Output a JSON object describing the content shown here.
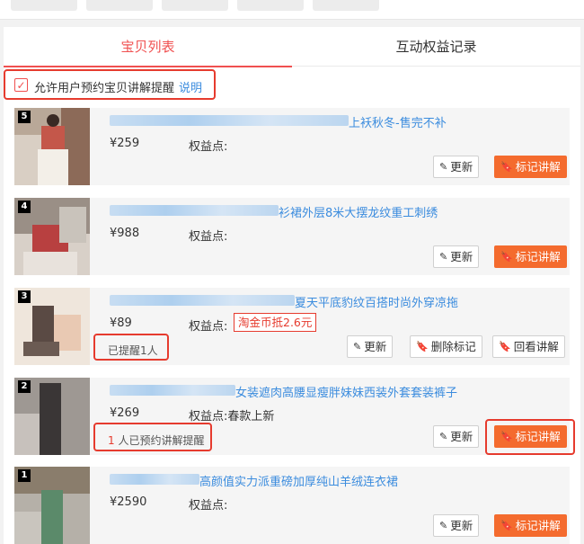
{
  "tabs": [
    {
      "label": "宝贝列表",
      "active": true
    },
    {
      "label": "互动权益记录",
      "active": false
    }
  ],
  "settings": {
    "allow_label": "允许用户预约宝贝讲解提醒",
    "help_link": "说明",
    "checked": true
  },
  "items": [
    {
      "rank": "5",
      "title": "上袄秋冬-售完不补",
      "price": "¥259",
      "rights_label": "权益点:",
      "rights_badge": "",
      "remind": "",
      "remind_count": "",
      "remind_suffix": "",
      "buttons": [
        "更新",
        "标记讲解"
      ]
    },
    {
      "rank": "4",
      "title": "衫裙外层8米大摆龙纹重工刺绣",
      "price": "¥988",
      "rights_label": "权益点:",
      "rights_badge": "",
      "remind": "",
      "remind_count": "",
      "remind_suffix": "",
      "buttons": [
        "更新",
        "标记讲解"
      ]
    },
    {
      "rank": "3",
      "title": "夏天平底豹纹百搭时尚外穿凉拖",
      "price": "¥89",
      "rights_label": "权益点:",
      "rights_badge": "淘金币抵2.6元",
      "remind": "已提醒1人",
      "remind_count": "",
      "remind_suffix": "",
      "buttons": [
        "更新",
        "删除标记",
        "回看讲解"
      ]
    },
    {
      "rank": "2",
      "title": "女装遮肉高腰显瘦胖妹妹西装外套套装裤子",
      "price": "¥269",
      "rights_label": "权益点:春款上新",
      "rights_badge": "",
      "remind": "",
      "remind_count": "1",
      "remind_suffix": "人已预约讲解提醒",
      "buttons": [
        "更新",
        "标记讲解"
      ]
    },
    {
      "rank": "1",
      "title": "高颜值实力派重磅加厚纯山羊绒连衣裙",
      "price": "¥2590",
      "rights_label": "权益点:",
      "rights_badge": "",
      "remind": "",
      "remind_count": "",
      "remind_suffix": "",
      "buttons": [
        "更新",
        "标记讲解"
      ]
    }
  ],
  "colors": {
    "accent": "#f05050",
    "button_primary": "#f46b2e",
    "link": "#3b8cde",
    "highlight": "#e63b2e"
  },
  "icons": {
    "check": "checkmark-icon",
    "update": "edit-icon",
    "mark": "bookmark-icon"
  }
}
